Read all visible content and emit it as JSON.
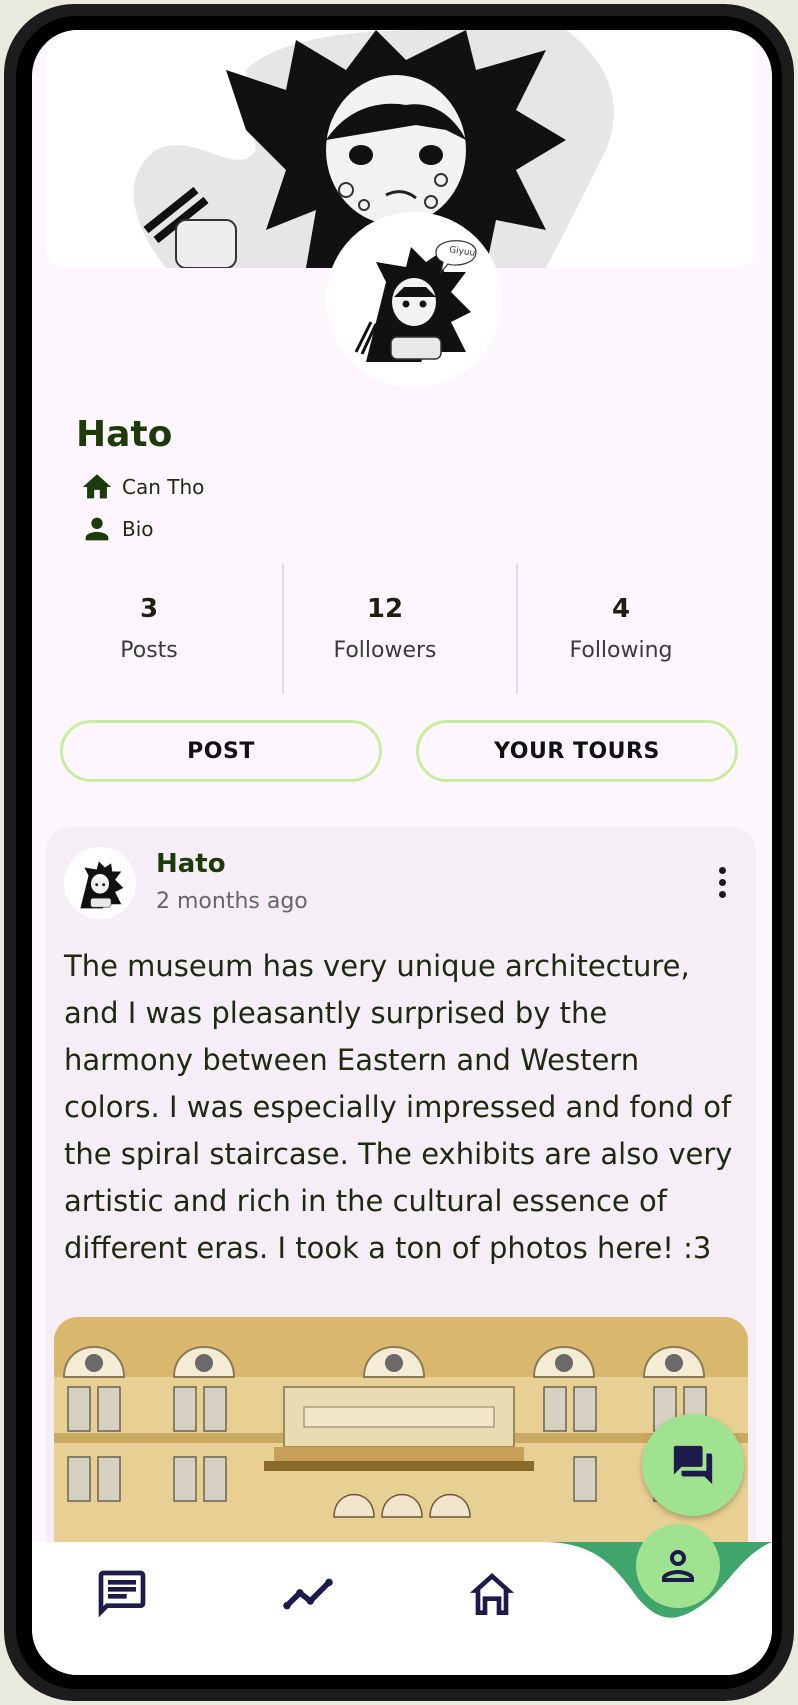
{
  "profile": {
    "name": "Hato",
    "location": "Can Tho",
    "bio_label": "Bio",
    "avatar_text": "Giyuu"
  },
  "stats": [
    {
      "value": "3",
      "label": "Posts"
    },
    {
      "value": "12",
      "label": "Followers"
    },
    {
      "value": "4",
      "label": "Following"
    }
  ],
  "actions": {
    "post_label": "POST",
    "tours_label": "YOUR TOURS"
  },
  "post": {
    "author": "Hato",
    "time": "2 months ago",
    "text": "The museum has very unique architecture, and I was pleasantly surprised by the harmony between Eastern and Western colors. I was especially impressed and fond of the spiral staircase. The exhibits are also very artistic and rich in the cultural essence of different eras. I took a ton of photos here! :3"
  },
  "icons": {
    "location": "home-icon",
    "bio": "person-icon",
    "more": "more-vert-icon",
    "fab": "forum-icon",
    "nav": [
      "chat-icon",
      "trending-icon",
      "home-icon",
      "person-icon"
    ]
  },
  "colors": {
    "accent": "#9fe28f",
    "nav_active": "#3fa56b",
    "button_border": "#c9ec9f",
    "name": "#1d3a0a",
    "background": "#fdf6ff"
  }
}
